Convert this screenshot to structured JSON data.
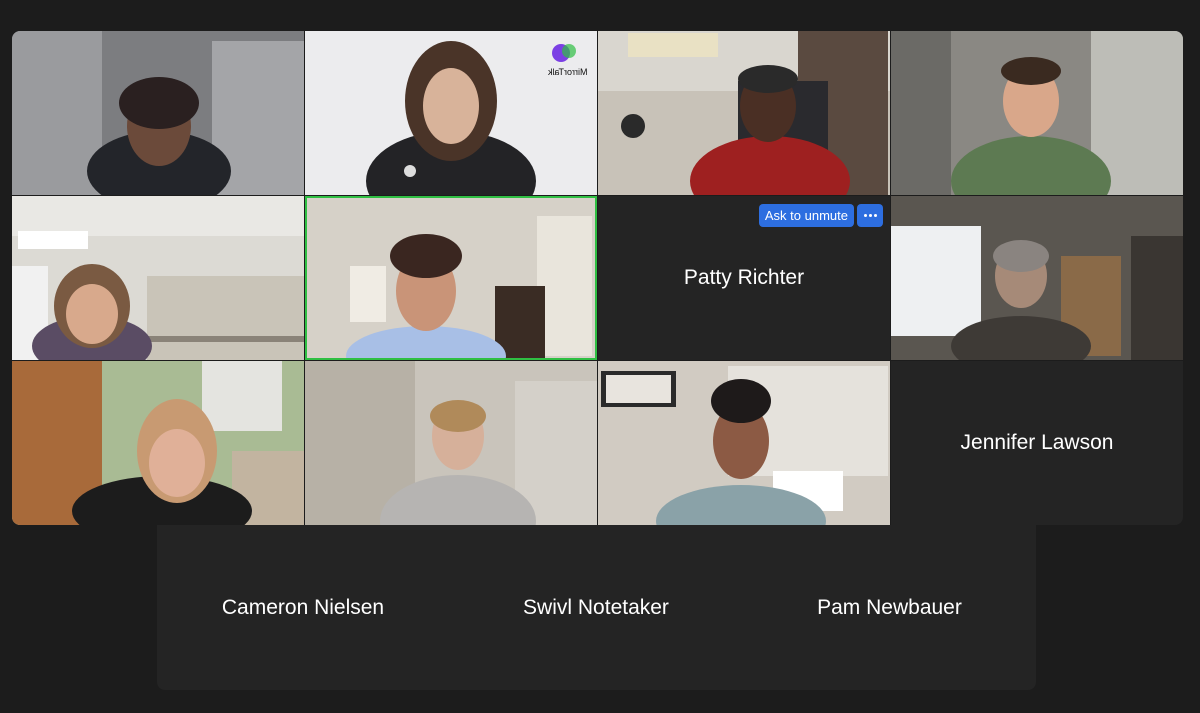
{
  "meeting": {
    "participants_video": [
      {
        "id": "p1"
      },
      {
        "id": "p2"
      },
      {
        "id": "p3"
      },
      {
        "id": "p4"
      },
      {
        "id": "p5"
      },
      {
        "id": "p6"
      },
      {
        "id": "p8"
      },
      {
        "id": "p9"
      },
      {
        "id": "p10"
      },
      {
        "id": "p11"
      }
    ],
    "patty": {
      "name": "Patty Richter",
      "ask_label": "Ask to unmute"
    },
    "jennifer": {
      "name": "Jennifer Lawson"
    },
    "bottom": {
      "names": [
        "Cameron Nielsen",
        "Swivl Notetaker",
        "Pam Newbauer"
      ]
    },
    "logo_text": "MirrorTalk",
    "active_speaker_color": "#2fbf43",
    "button_color": "#2d6ee0"
  }
}
